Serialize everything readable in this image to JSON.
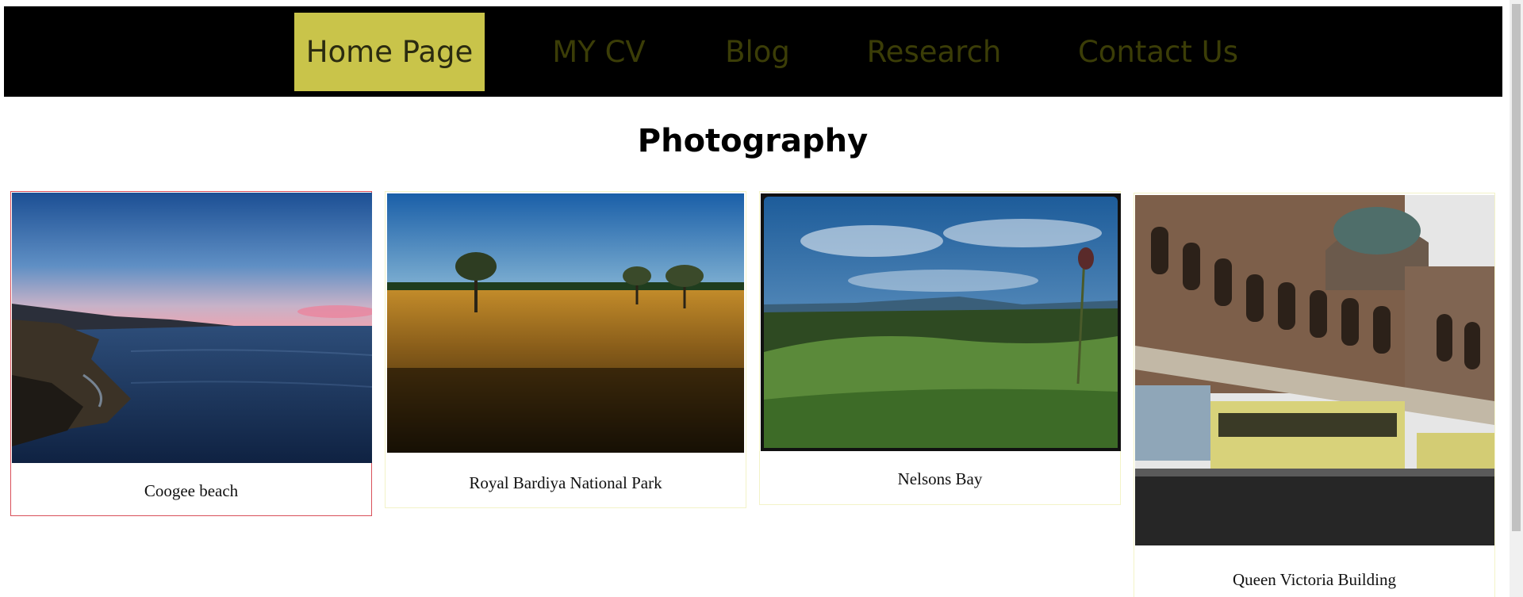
{
  "nav": {
    "items": [
      {
        "label": "Home Page",
        "active": true
      },
      {
        "label": "MY CV",
        "active": false
      },
      {
        "label": "Blog",
        "active": false
      },
      {
        "label": "Research",
        "active": false
      },
      {
        "label": "Contact Us",
        "active": false
      }
    ],
    "active_color": "#c9c44a",
    "bar_color": "#000000",
    "link_color": "#3b3d07"
  },
  "heading": "Photography",
  "gallery": [
    {
      "caption": "Coogee beach",
      "image": "coastal-sunset-photo"
    },
    {
      "caption": "Royal Bardiya National Park",
      "image": "grassland-trees-photo"
    },
    {
      "caption": "Nelsons Bay",
      "image": "hilltop-vegetation-photo"
    },
    {
      "caption": "Queen Victoria Building",
      "image": "historic-building-buses-photo"
    }
  ]
}
